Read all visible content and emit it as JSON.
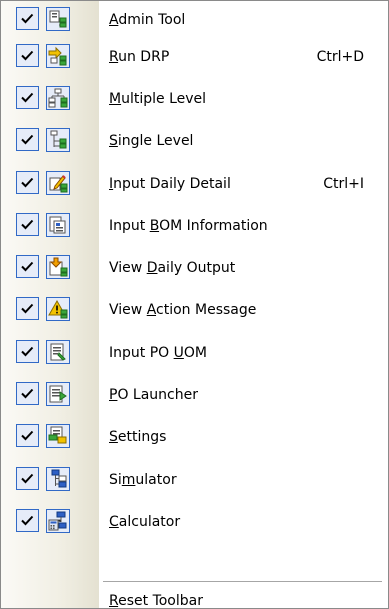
{
  "menu": {
    "items": [
      {
        "pre": "",
        "accel": "A",
        "post": "dmin Tool",
        "shortcut": "",
        "checked": true,
        "icon": "admin-tool-icon"
      },
      {
        "pre": "",
        "accel": "R",
        "post": "un DRP",
        "shortcut": "Ctrl+D",
        "checked": true,
        "icon": "run-drp-icon"
      },
      {
        "pre": "",
        "accel": "M",
        "post": "ultiple Level",
        "shortcut": "",
        "checked": true,
        "icon": "multiple-level-icon"
      },
      {
        "pre": "",
        "accel": "S",
        "post": "ingle Level",
        "shortcut": "",
        "checked": true,
        "icon": "single-level-icon"
      },
      {
        "pre": "",
        "accel": "I",
        "post": "nput Daily Detail",
        "shortcut": "Ctrl+I",
        "checked": true,
        "icon": "input-daily-detail-icon"
      },
      {
        "pre": "Input ",
        "accel": "B",
        "post": "OM Information",
        "shortcut": "",
        "checked": true,
        "icon": "input-bom-icon"
      },
      {
        "pre": "View ",
        "accel": "D",
        "post": "aily Output",
        "shortcut": "",
        "checked": true,
        "icon": "view-daily-output-icon"
      },
      {
        "pre": "View ",
        "accel": "A",
        "post": "ction Message",
        "shortcut": "",
        "checked": true,
        "icon": "warning-icon"
      },
      {
        "pre": "Input PO ",
        "accel": "U",
        "post": "OM",
        "shortcut": "",
        "checked": true,
        "icon": "input-po-uom-icon"
      },
      {
        "pre": "",
        "accel": "P",
        "post": "O Launcher",
        "shortcut": "",
        "checked": true,
        "icon": "po-launcher-icon"
      },
      {
        "pre": "",
        "accel": "S",
        "post": "ettings",
        "shortcut": "",
        "checked": true,
        "icon": "settings-icon"
      },
      {
        "pre": "Si",
        "accel": "m",
        "post": "ulator",
        "shortcut": "",
        "checked": true,
        "icon": "simulator-icon"
      },
      {
        "pre": "",
        "accel": "C",
        "post": "alculator",
        "shortcut": "",
        "checked": true,
        "icon": "calculator-icon"
      }
    ],
    "reset": {
      "pre": "",
      "accel": "R",
      "post": "eset Toolbar"
    }
  },
  "colors": {
    "highlight_border": "#3169c6",
    "highlight_fill": "#e6ecf8",
    "icon_green": "#3aa63a",
    "icon_yellow": "#f2c200",
    "icon_blue": "#2d5fc4"
  }
}
